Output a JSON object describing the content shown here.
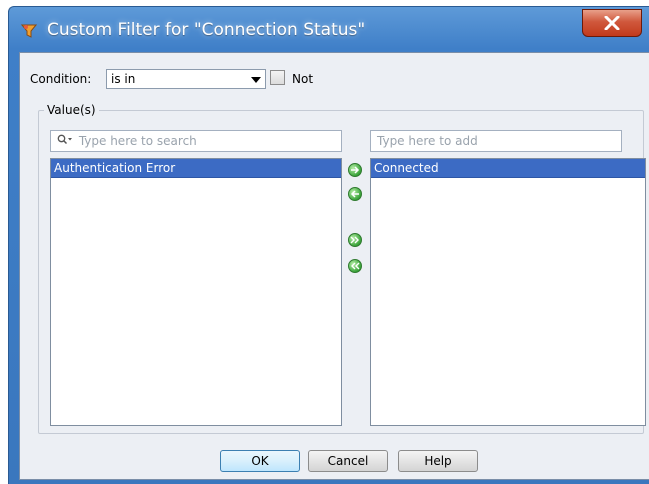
{
  "window": {
    "title": "Custom Filter for \"Connection Status\""
  },
  "condition": {
    "label": "Condition:",
    "value": "is in",
    "not_label": "Not",
    "not_checked": false
  },
  "values_group": {
    "label": "Value(s)"
  },
  "left_panel": {
    "search_placeholder": "Type here to search",
    "items": [
      "Authentication Error"
    ]
  },
  "right_panel": {
    "add_placeholder": "Type here to add",
    "items": [
      "Connected"
    ]
  },
  "buttons": {
    "ok": "OK",
    "cancel": "Cancel",
    "help": "Help"
  },
  "icons": {
    "app": "filter-funnel-icon",
    "close": "close-icon",
    "search": "search-icon",
    "add": "plus-icon",
    "move_right": "arrow-right-icon",
    "move_left": "arrow-left-icon",
    "move_all_right": "double-arrow-right-icon",
    "move_all_left": "double-arrow-left-icon"
  },
  "colors": {
    "titlebar": "#3f7fc8",
    "selection": "#3c6bc4",
    "close": "#c23a1c",
    "arrow_buttons": "#3aa33a"
  }
}
